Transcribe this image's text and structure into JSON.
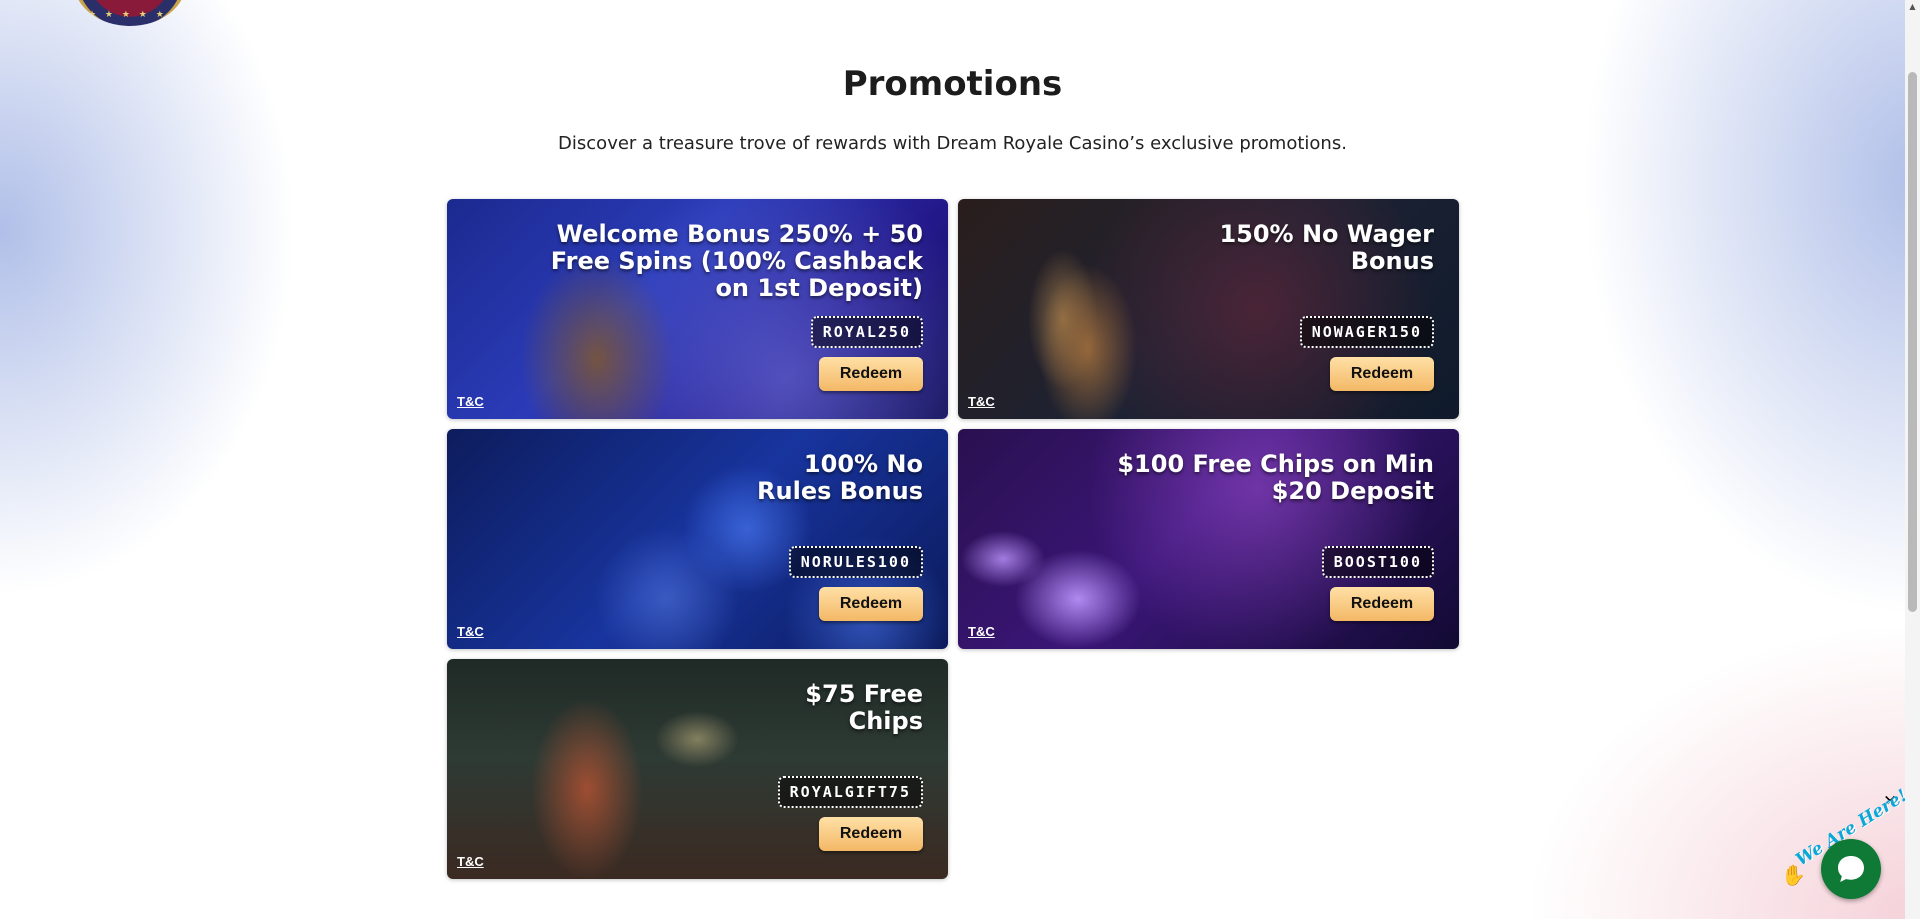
{
  "page": {
    "title": "Promotions",
    "subtitle": "Discover a treasure trove of rewards with Dream Royale Casino’s exclusive promotions."
  },
  "promotions": [
    {
      "title": "Welcome Bonus 250% + 50 Free Spins (100% Cashback on 1st Deposit)",
      "code": "ROYAL250",
      "button": "Redeem",
      "terms": "T&C"
    },
    {
      "title": "150% No Wager Bonus",
      "code": "NOWAGER150",
      "button": "Redeem",
      "terms": "T&C"
    },
    {
      "title": "100% No Rules Bonus",
      "code": "NORULES100",
      "button": "Redeem",
      "terms": "T&C"
    },
    {
      "title": "$100 Free Chips on Min $20 Deposit",
      "code": "BOOST100",
      "button": "Redeem",
      "terms": "T&C"
    },
    {
      "title": "$75 Free Chips",
      "code": "ROYALGIFT75",
      "button": "Redeem",
      "terms": "T&C"
    }
  ],
  "chat_widget": {
    "tagline": "We Are Here!",
    "close_symbol": "✕",
    "icon": "chat-bubble-icon"
  },
  "colors": {
    "redeem_button": "#f3b866",
    "chat_button": "#0f7a35",
    "tagline": "#0aa8d9"
  }
}
